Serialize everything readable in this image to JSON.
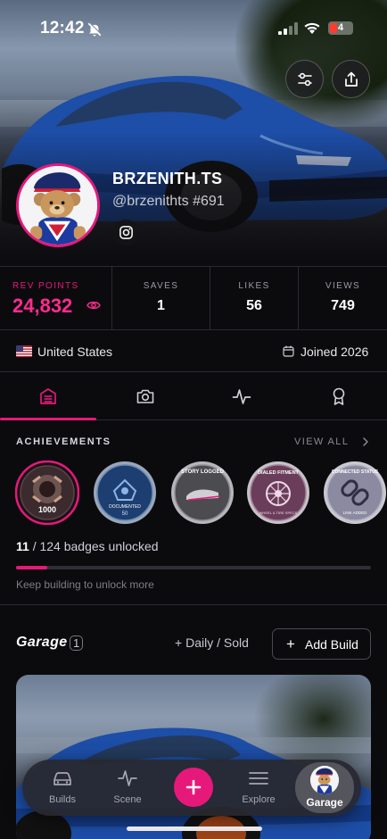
{
  "status_bar": {
    "time": "12:42",
    "battery": "4"
  },
  "profile": {
    "display_name": "BRZENITH.TS",
    "handle": "@brzenithts",
    "number": "#691"
  },
  "stats": [
    {
      "label": "REV POINTS",
      "value": "24,832"
    },
    {
      "label": "SAVES",
      "value": "1"
    },
    {
      "label": "LIKES",
      "value": "56"
    },
    {
      "label": "VIEWS",
      "value": "749"
    }
  ],
  "info": {
    "country": "United States",
    "joined": "Joined 2026"
  },
  "tabs": [
    {
      "icon": "garage-icon",
      "active": true
    },
    {
      "icon": "camera-icon",
      "active": false
    },
    {
      "icon": "activity-icon",
      "active": false
    },
    {
      "icon": "award-icon",
      "active": false
    }
  ],
  "achievements": {
    "heading": "ACHIEVEMENTS",
    "view_all": "VIEW ALL",
    "badges": [
      {
        "label": "1000"
      },
      {
        "label": "DOCUMENTED",
        "sub": "50"
      },
      {
        "label": "STORY LOGGED"
      },
      {
        "label": "DIALED FITMENT",
        "sub": "WHEEL & TIRE SPECS"
      },
      {
        "label": "CONNECTED STATUS",
        "sub": "LINK ADDED"
      }
    ],
    "unlocked": "11",
    "total": "124",
    "unlocked_suffix": "badges unlocked",
    "progress": 0.089,
    "hint": "Keep building to unlock more"
  },
  "garage": {
    "title": "Garage",
    "count": "1",
    "filter_label": "Daily / Sold",
    "add_label": "Add Build"
  },
  "nav": {
    "builds": "Builds",
    "scene": "Scene",
    "explore": "Explore",
    "garage": "Garage"
  },
  "colors": {
    "accent": "#e6197a",
    "accent_text": "#ff2b8f",
    "background": "#0b0b0e"
  }
}
